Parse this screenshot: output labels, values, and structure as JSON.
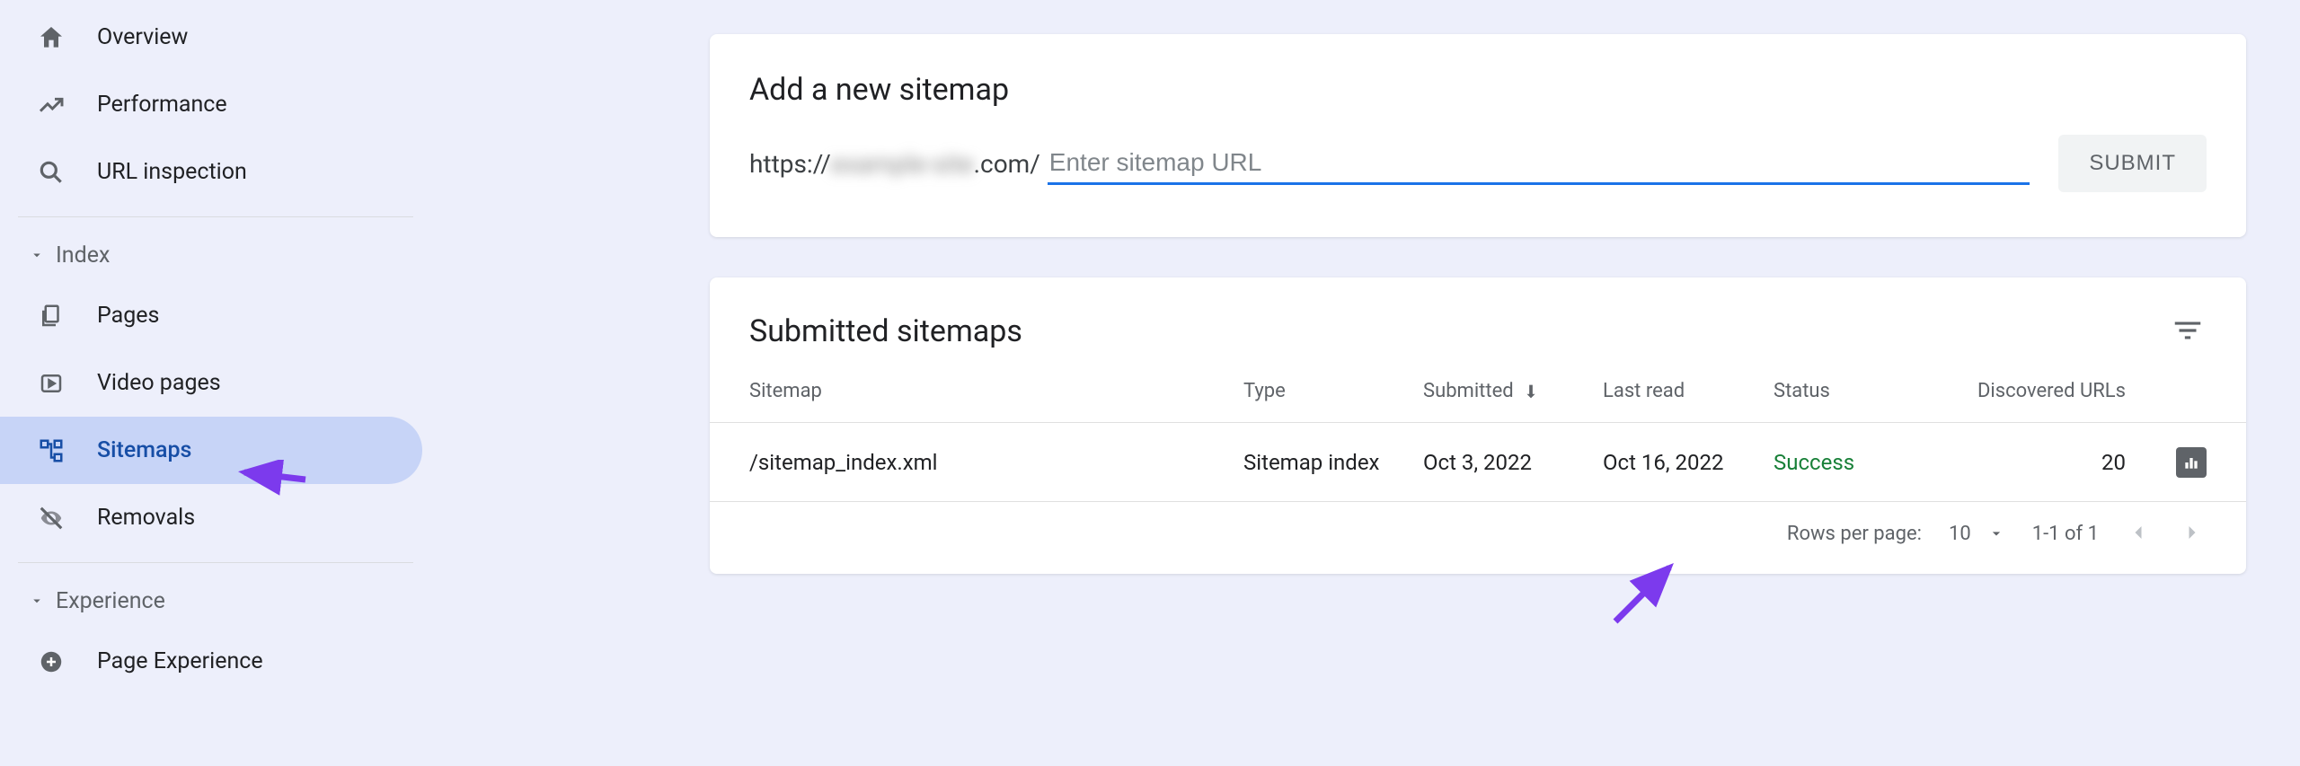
{
  "sidebar": {
    "items": {
      "overview": "Overview",
      "performance": "Performance",
      "url_inspection": "URL inspection",
      "pages": "Pages",
      "video_pages": "Video pages",
      "sitemaps": "Sitemaps",
      "removals": "Removals",
      "page_experience": "Page Experience"
    },
    "sections": {
      "index": "Index",
      "experience": "Experience"
    }
  },
  "add_sitemap": {
    "title": "Add a new sitemap",
    "url_prefix_left": "https://",
    "url_prefix_blur": "example-site",
    "url_prefix_right": ".com/",
    "placeholder": "Enter sitemap URL",
    "submit": "SUBMIT"
  },
  "submitted": {
    "title": "Submitted sitemaps",
    "columns": {
      "sitemap": "Sitemap",
      "type": "Type",
      "submitted": "Submitted",
      "last_read": "Last read",
      "status": "Status",
      "discovered": "Discovered URLs"
    },
    "rows": [
      {
        "sitemap": "/sitemap_index.xml",
        "type": "Sitemap index",
        "submitted": "Oct 3, 2022",
        "last_read": "Oct 16, 2022",
        "status": "Success",
        "discovered": "20"
      }
    ],
    "pagination": {
      "rows_label": "Rows per page:",
      "rows_value": "10",
      "range": "1-1 of 1"
    }
  }
}
